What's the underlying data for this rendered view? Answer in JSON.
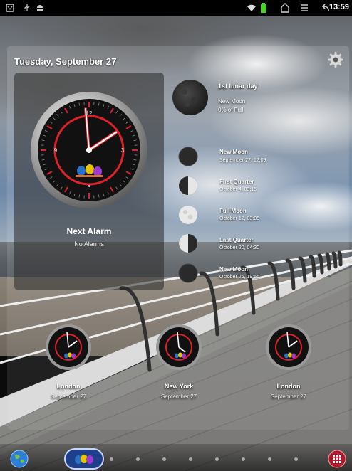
{
  "status_bar": {
    "time": "13:59",
    "icons": [
      "tablet-icon",
      "usb-icon",
      "android-icon",
      "wifi-icon",
      "battery-icon",
      "bag-icon",
      "menu-icon",
      "back-icon"
    ]
  },
  "widget": {
    "date": "Tuesday, September 27",
    "settings_icon": "gear-icon",
    "next_alarm_title": "Next Alarm",
    "next_alarm_value": "No Alarms",
    "moon_today": {
      "title": "1st lunar day",
      "phase": "New Moon",
      "illumination": "0% of Full"
    },
    "moon_phases": [
      {
        "name": "New Moon",
        "date": "September 27, 12:09"
      },
      {
        "name": "First Quarter",
        "date": "October 4, 03:15"
      },
      {
        "name": "Full Moon",
        "date": "October 12, 03:06"
      },
      {
        "name": "Last Quarter",
        "date": "October 20, 04:30"
      },
      {
        "name": "New Moon",
        "date": "October 26, 19:56"
      }
    ],
    "world_clocks": [
      {
        "city": "London",
        "date": "September 27"
      },
      {
        "city": "New York",
        "date": "September 27"
      },
      {
        "city": "London",
        "date": "September 27"
      }
    ]
  },
  "dock": {
    "left_icon": "globe-icon",
    "center_icon": "app-switcher-icon",
    "right_icon": "app-drawer-icon"
  },
  "colors": {
    "accent": "#e0202a",
    "clock_face": "#111111"
  }
}
